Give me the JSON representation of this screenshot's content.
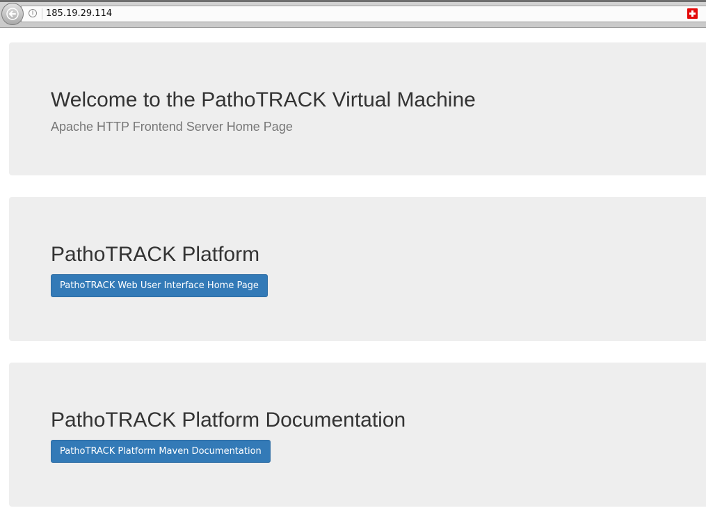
{
  "browser": {
    "url": "185.19.29.114",
    "info_icon_glyph": "i",
    "country_flag": "switzerland-flag-icon"
  },
  "colors": {
    "panel_bg": "#eeeeee",
    "button_bg": "#337ab7",
    "heading": "#333333",
    "subtitle": "#777777"
  },
  "hero": {
    "title": "Welcome to the PathoTRACK Virtual Machine",
    "subtitle": "Apache HTTP Frontend Server Home Page"
  },
  "platform": {
    "title": "PathoTRACK Platform",
    "button_label": "PathoTRACK Web User Interface Home Page"
  },
  "docs": {
    "title": "PathoTRACK Platform Documentation",
    "button_label": "PathoTRACK Platform Maven Documentation"
  }
}
